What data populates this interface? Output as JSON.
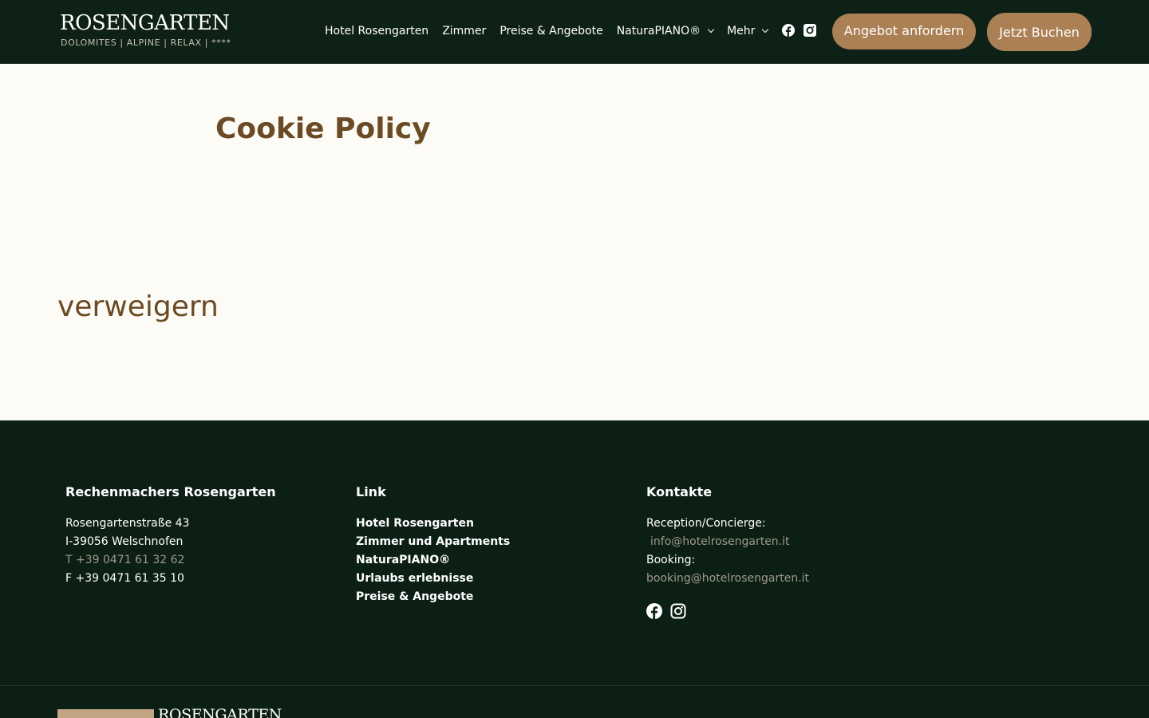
{
  "brand": {
    "logo_main": "ROSENGARTEN",
    "logo_sub": "DOLOMITES | ALPINE | RELAX | ****"
  },
  "nav": {
    "items": [
      {
        "label": "Hotel Rosengarten",
        "has_dropdown": false
      },
      {
        "label": "Zimmer",
        "has_dropdown": false
      },
      {
        "label": "Preise & Angebote",
        "has_dropdown": false
      },
      {
        "label": "NaturaPIANO®",
        "has_dropdown": true
      },
      {
        "label": "Mehr",
        "has_dropdown": true
      }
    ],
    "social_icons": [
      "facebook-icon",
      "instagram-icon"
    ],
    "offer_button": "Angebot anfordern",
    "book_button": "Jetzt Buchen"
  },
  "main": {
    "title": "Cookie Policy",
    "refuse_label": "verweigern"
  },
  "footer": {
    "address": {
      "title": "Rechenmachers Rosengarten",
      "street": "Rosengartenstraße 43",
      "city": "I-39056 Welschnofen",
      "phone": "T +39 0471 61 32 62",
      "fax": "F +39 0471 61 35 10"
    },
    "links": {
      "title": "Link",
      "items": [
        "Hotel Rosengarten",
        "Zimmer und Apartments",
        "NaturaPIANO®",
        "Urlaubs erlebnisse",
        "Preise & Angebote"
      ]
    },
    "contact": {
      "title": "Kontakte",
      "reception_label": "Reception/Concierge:",
      "reception_email": "info@hotelrosengarten.it",
      "booking_label": "Booking:",
      "booking_email": "booking@hotelrosengarten.it",
      "social_icons": [
        "facebook-icon",
        "instagram-icon"
      ]
    },
    "bottom_logo": "ROSENGARTEN"
  },
  "colors": {
    "header_bg": "#0e2117",
    "footer_bg": "#0b1f15",
    "page_bg": "#fdfbf5",
    "accent": "#ac8055",
    "heading": "#6b4a26"
  }
}
